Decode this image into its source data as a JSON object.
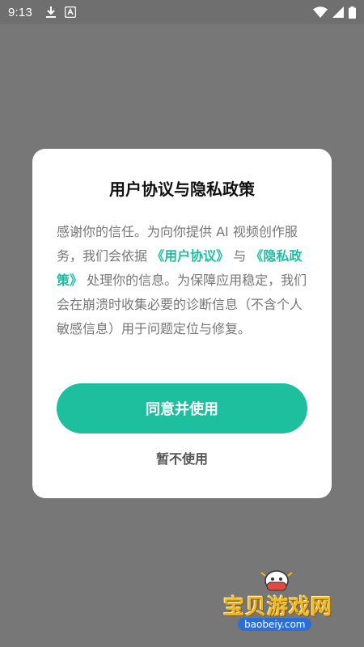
{
  "status_bar": {
    "time": "9:13",
    "icons": [
      "download-icon",
      "app-notification-icon",
      "wifi-icon",
      "signal-icon",
      "battery-icon"
    ]
  },
  "dialog": {
    "title": "用户协议与隐私政策",
    "body": {
      "text_1": "感谢你的信任。为向你提供 AI 视频创作服务，我们会依据",
      "link_user_agreement": "《用户协议》",
      "text_2": "与",
      "link_privacy_policy": "《隐私政策》",
      "text_3": "处理你的信息。为保障应用稳定，我们会在崩溃时收集必要的诊断信息（不含个人敏感信息）用于问题定位与修复。"
    },
    "agree_button_label": "同意并使用",
    "decline_button_label": "暂不使用"
  },
  "watermark": {
    "title": "宝贝游戏网",
    "url": "baobeiy.com"
  },
  "colors": {
    "accent": "#1dbf9e",
    "overlay": "#777777",
    "status_bar": "#6f6f6f",
    "watermark_yellow": "#f2b81e",
    "watermark_blue": "#2b6fd6"
  }
}
